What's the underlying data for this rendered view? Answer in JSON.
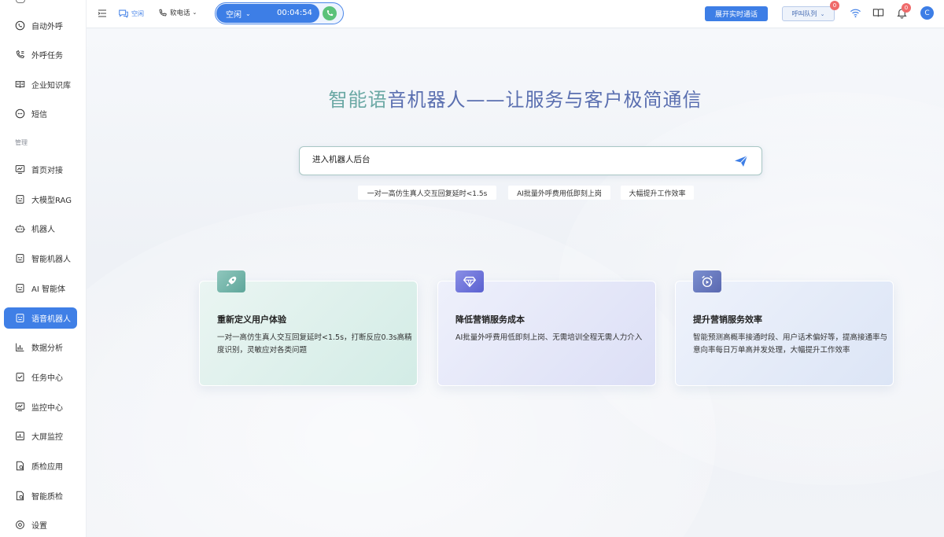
{
  "sidebar": {
    "section_manage": "管理",
    "items": [
      {
        "label": "自动外呼",
        "icon": "whatsapp-phone-icon"
      },
      {
        "label": "外呼任务",
        "icon": "phone-list-icon"
      },
      {
        "label": "企业知识库",
        "icon": "book-icon"
      },
      {
        "label": "短信",
        "icon": "sms-icon"
      },
      {
        "label": "首页对接",
        "icon": "chart-monitor-icon"
      },
      {
        "label": "大模型RAG",
        "icon": "robot-box-icon"
      },
      {
        "label": "机器人",
        "icon": "robot-icon"
      },
      {
        "label": "智能机器人",
        "icon": "robot-box-icon"
      },
      {
        "label": "AI 智能体",
        "icon": "robot-box-icon"
      },
      {
        "label": "语音机器人",
        "icon": "robot-box-icon",
        "active": true
      },
      {
        "label": "数据分析",
        "icon": "bar-chart-icon"
      },
      {
        "label": "任务中心",
        "icon": "checklist-icon"
      },
      {
        "label": "监控中心",
        "icon": "monitor-icon"
      },
      {
        "label": "大屏监控",
        "icon": "bar-chart-icon"
      },
      {
        "label": "质检应用",
        "icon": "doc-check-icon"
      },
      {
        "label": "智能质检",
        "icon": "doc-check-icon"
      },
      {
        "label": "设置",
        "icon": "gear-icon"
      }
    ]
  },
  "header": {
    "status_label": "空闲",
    "softphone_label": "软电话",
    "call_state": "空闲",
    "call_timer": "00:04:54",
    "expand_button": "展开实时通话",
    "queue_label": "呼叫队列",
    "queue_badge": "0",
    "notification_badge": "0",
    "avatar_letter": "C"
  },
  "main": {
    "title_part1": "智能语",
    "title_part2": "音机器人——让服务与客户极简通信",
    "search_placeholder": "进入机器人后台",
    "tags": [
      "一对一高仿生真人交互回复延时<1.5s",
      "AI批量外呼费用低即刻上岗",
      "大幅提升工作效率"
    ],
    "cards": [
      {
        "title": "重新定义用户体验",
        "desc": "一对一高仿生真人交互回复延时<1.5s，打断反应0.3s高精度识别，灵敏应对各类问题",
        "icon": "rocket-icon"
      },
      {
        "title": "降低营销服务成本",
        "desc": "AI批量外呼费用低即刻上岗、无需培训全程无需人力介入",
        "icon": "diamond-icon"
      },
      {
        "title": "提升营销服务效率",
        "desc": "智能预测高概率接通时段、用户话术偏好等，提高接通率与意向率每日万单高并发处理，大幅提升工作效率",
        "icon": "alarm-clock-icon"
      }
    ]
  }
}
